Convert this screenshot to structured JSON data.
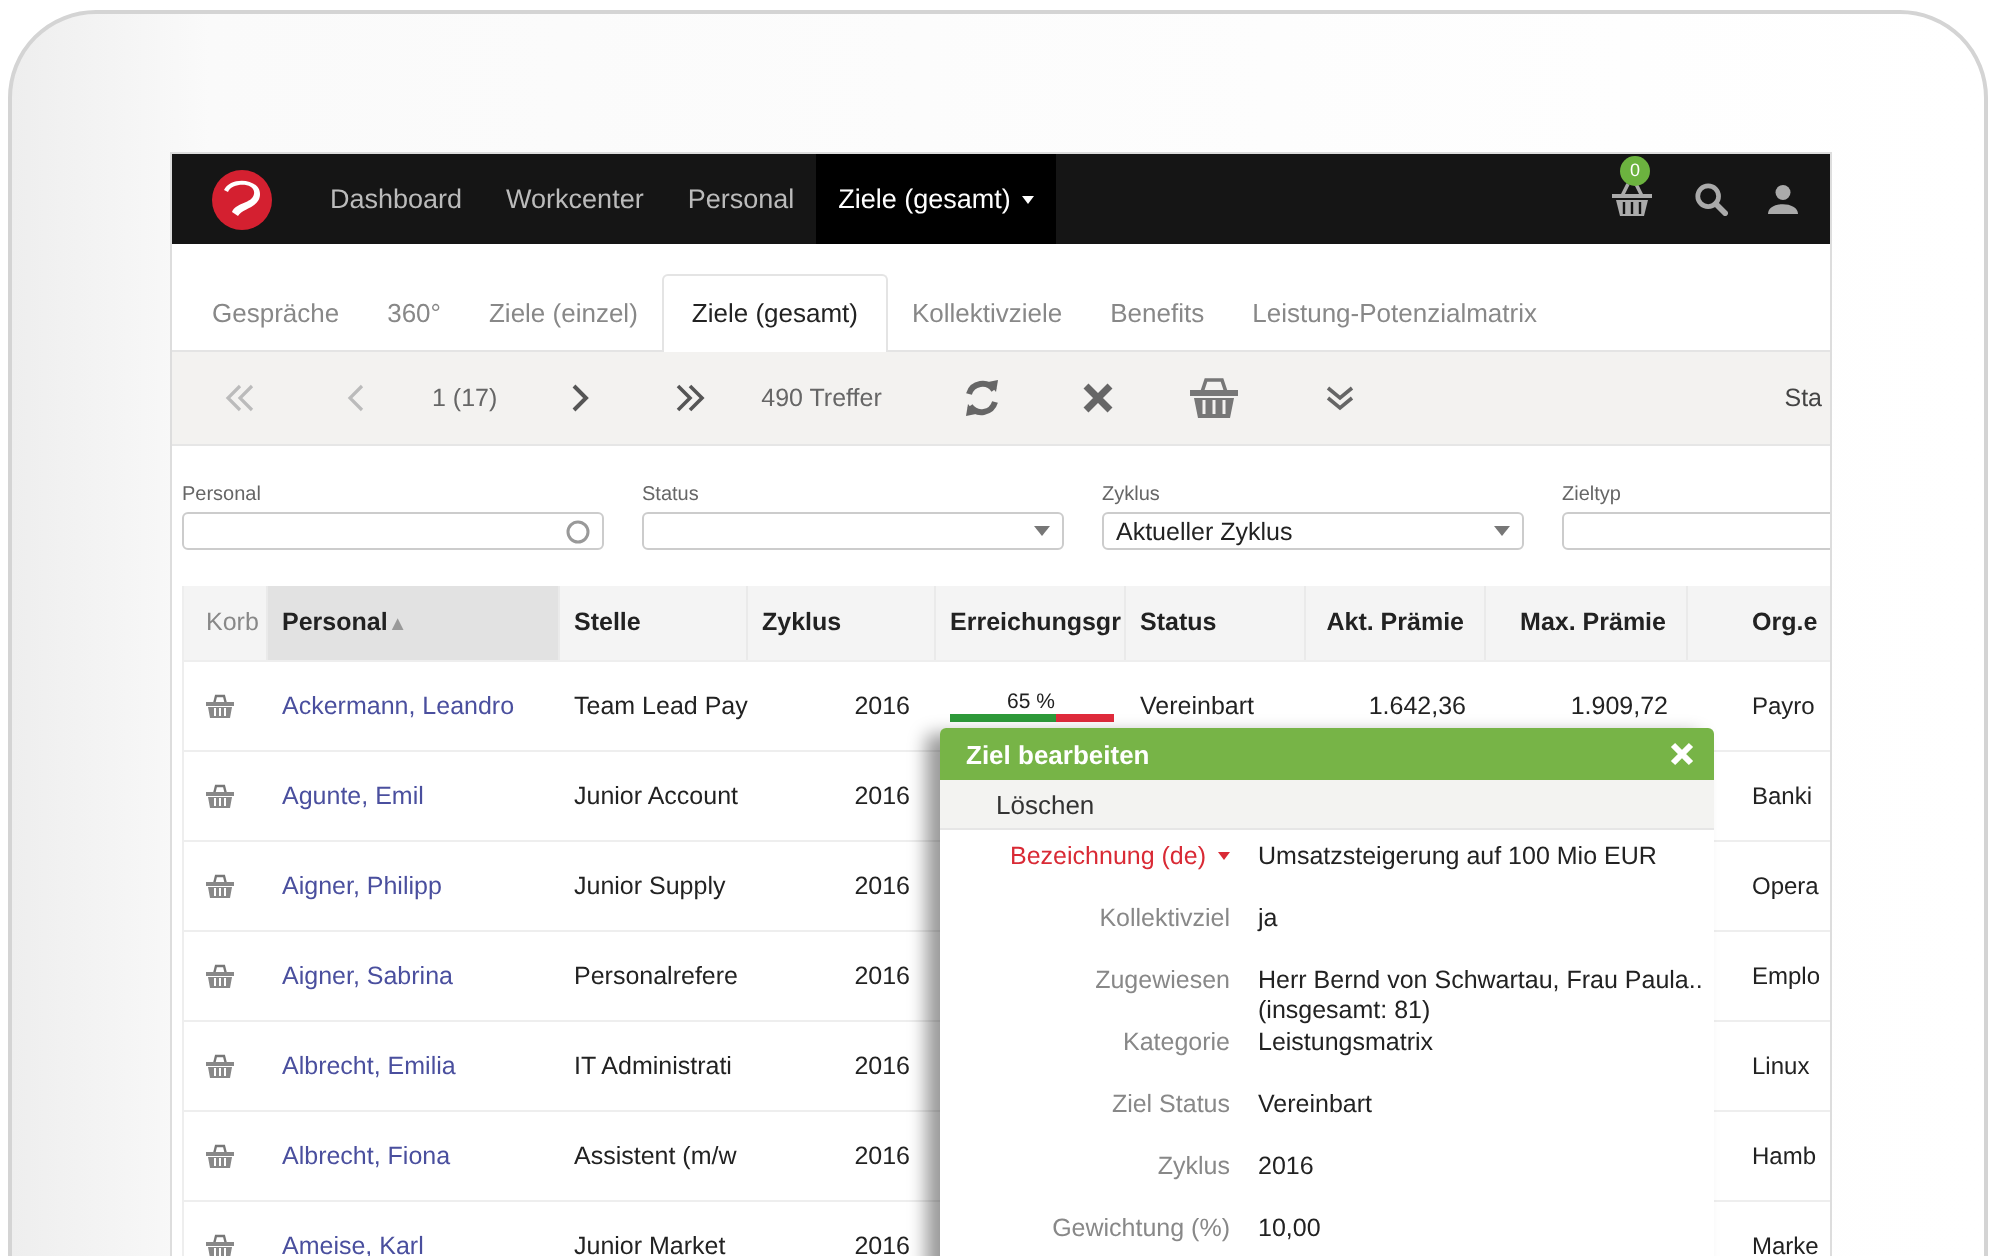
{
  "navbar": {
    "items": [
      {
        "label": "Dashboard",
        "selected": false,
        "dropdown": false
      },
      {
        "label": "Workcenter",
        "selected": false,
        "dropdown": false
      },
      {
        "label": "Personal",
        "selected": false,
        "dropdown": false
      },
      {
        "label": "Ziele (gesamt)",
        "selected": true,
        "dropdown": true
      }
    ],
    "cart_count": "0"
  },
  "tabs": [
    {
      "label": "Gespräche",
      "selected": false
    },
    {
      "label": "360°",
      "selected": false
    },
    {
      "label": "Ziele (einzel)",
      "selected": false
    },
    {
      "label": "Ziele (gesamt)",
      "selected": true
    },
    {
      "label": "Kollektivziele",
      "selected": false
    },
    {
      "label": "Benefits",
      "selected": false
    },
    {
      "label": "Leistung-Potenzialmatrix",
      "selected": false
    }
  ],
  "toolbar": {
    "page": "1 (17)",
    "hits": "490 Treffer",
    "right_label": "Sta"
  },
  "filters": [
    {
      "label": "Personal",
      "kind": "search"
    },
    {
      "label": "Status",
      "kind": "select"
    },
    {
      "label": "Zyklus",
      "value": "Aktueller Zyklus",
      "kind": "select"
    },
    {
      "label": "Zieltyp",
      "kind": "text"
    }
  ],
  "table": {
    "columns": [
      {
        "label": "Korb",
        "sorted": false
      },
      {
        "label": "Personal",
        "sorted": true
      },
      {
        "label": "Stelle",
        "sorted": false
      },
      {
        "label": "Zyklus",
        "sorted": false
      },
      {
        "label": "Erreichungsgr",
        "sorted": false
      },
      {
        "label": "Status",
        "sorted": false
      },
      {
        "label": "Akt. Prämie",
        "sorted": false
      },
      {
        "label": "Max. Prämie",
        "sorted": false
      },
      {
        "label": "Org.e",
        "sorted": false
      }
    ],
    "sort_mark": "▲",
    "rows": [
      {
        "name": "Ackermann, Leandro",
        "position": "Team Lead Pay",
        "cycle": "2016",
        "achievement": {
          "label": "65 %",
          "level": 0.65
        },
        "status": "Vereinbart",
        "current_bonus": "1.642,36",
        "max_bonus": "1.909,72",
        "org": "Payro"
      },
      {
        "name": "Agunte, Emil",
        "position": "Junior Account",
        "cycle": "2016",
        "org": "Banki"
      },
      {
        "name": "Aigner, Philipp",
        "position": "Junior Supply",
        "cycle": "2016",
        "org": "Opera"
      },
      {
        "name": "Aigner, Sabrina",
        "position": "Personalrefere",
        "cycle": "2016",
        "org": "Emplo"
      },
      {
        "name": "Albrecht, Emilia",
        "position": "IT Administrati",
        "cycle": "2016",
        "org": "Linux"
      },
      {
        "name": "Albrecht, Fiona",
        "position": "Assistent (m/w",
        "cycle": "2016",
        "org": "Hamb"
      },
      {
        "name": "Ameise, Karl",
        "position": "Junior Market",
        "cycle": "2016",
        "org": "Marke"
      }
    ]
  },
  "dialog": {
    "title": "Ziel bearbeiten",
    "action": "Löschen",
    "fields": [
      {
        "label": "Bezeichnung (de)",
        "kind": "language",
        "value": "Umsatzsteigerung auf 100 Mio EUR"
      },
      {
        "label": "Kollektivziel",
        "kind": "plain",
        "value": "ja"
      },
      {
        "label": "Zugewiesen",
        "kind": "plain",
        "value": "Herr Bernd von Schwartau, Frau Paula..",
        "detail": "(insgesamt: 81)"
      },
      {
        "label": "Kategorie",
        "kind": "plain",
        "value": "Leistungsmatrix"
      },
      {
        "label": "Ziel Status",
        "kind": "plain",
        "value": "Vereinbart"
      },
      {
        "label": "Zyklus",
        "kind": "plain",
        "value": "2016"
      },
      {
        "label": "Gewichtung (%)",
        "kind": "plain",
        "value": "10,00"
      }
    ]
  }
}
